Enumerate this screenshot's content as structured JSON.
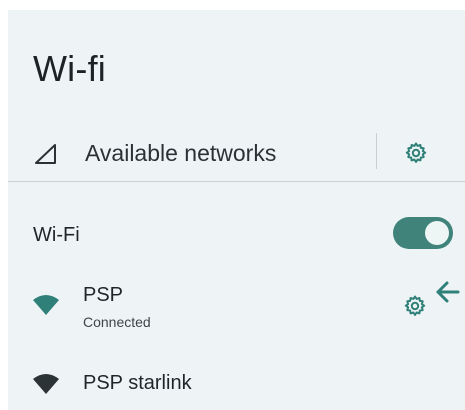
{
  "page": {
    "title": "Wi-fi"
  },
  "available": {
    "icon": "signal-triangle-icon",
    "label": "Available networks",
    "settings_icon": "gear-icon"
  },
  "wifi_toggle": {
    "label": "Wi-Fi",
    "state": "on"
  },
  "networks": [
    {
      "name": "PSP",
      "status": "Connected",
      "icon": "wifi-signal-icon",
      "icon_color": "#2f8079",
      "settings_icon": "gear-icon"
    },
    {
      "name": "PSP starlink",
      "status": "",
      "icon": "wifi-signal-icon",
      "icon_color": "#2c3336"
    }
  ],
  "colors": {
    "accent": "#2f8079",
    "toggle_track": "#3f837b",
    "background": "#eef4f6"
  },
  "arrow_icon": "arrow-left-icon"
}
